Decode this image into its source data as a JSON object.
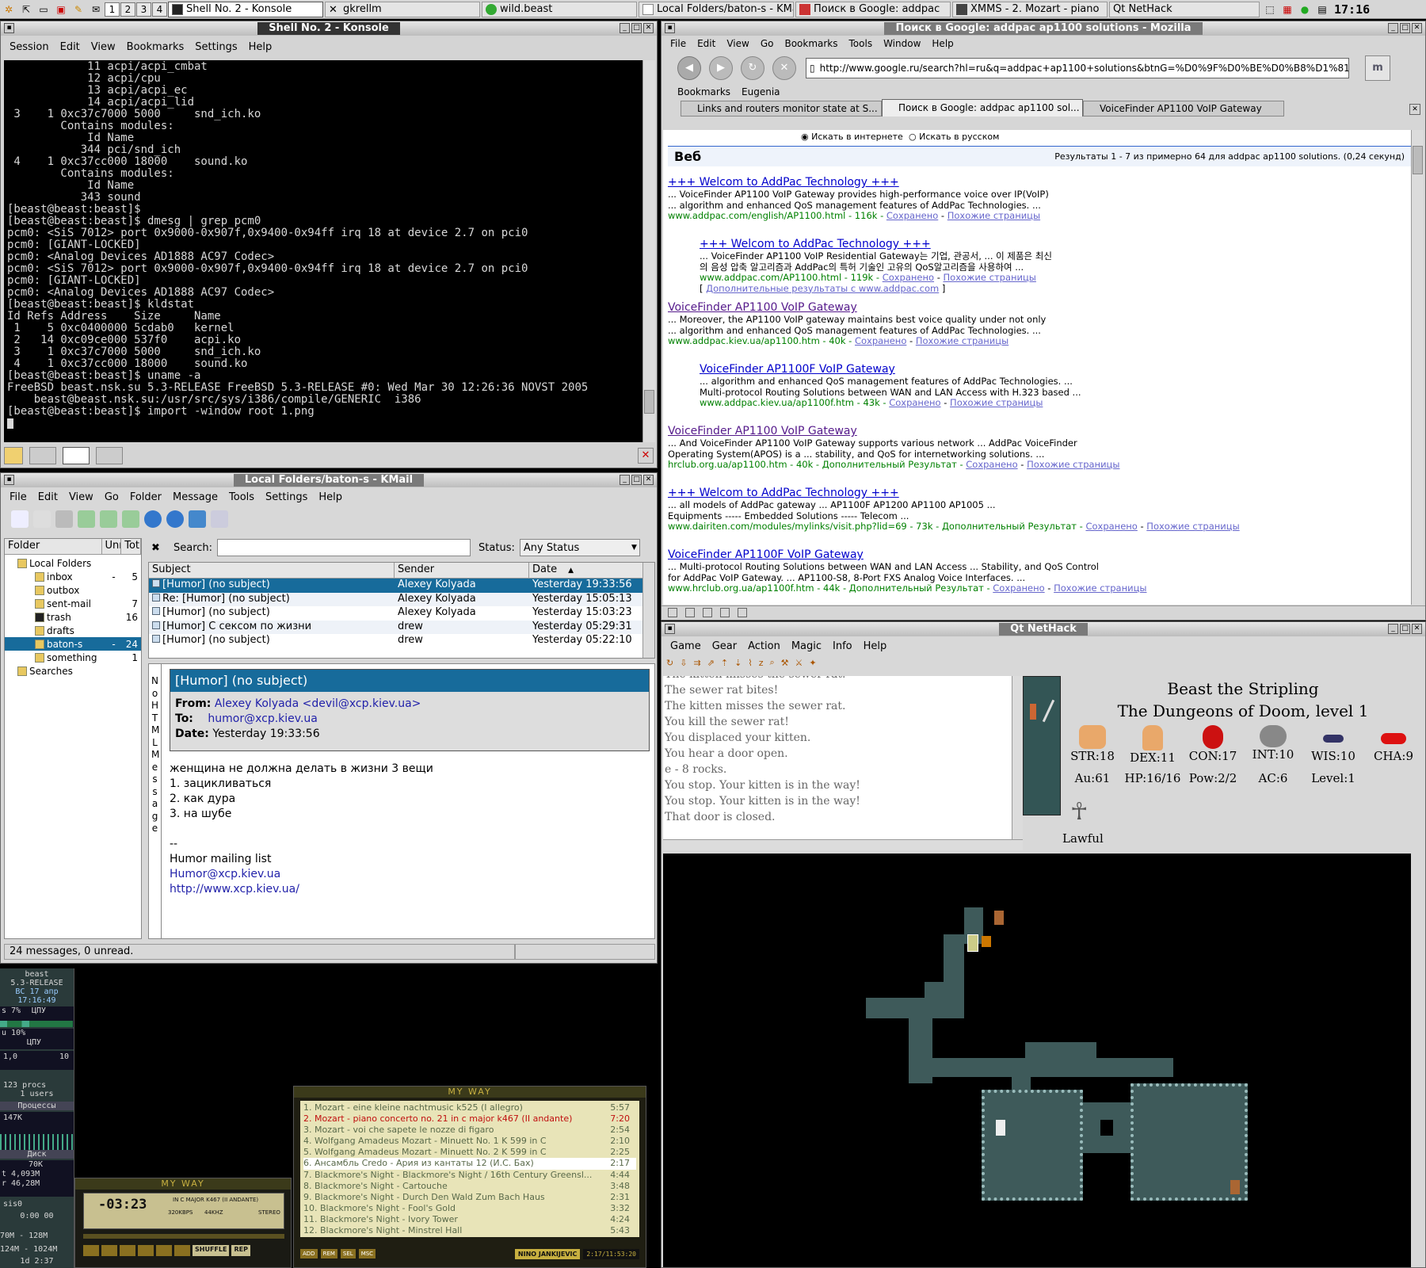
{
  "taskbar": {
    "desktops": [
      "1",
      "2",
      "3",
      "4"
    ],
    "tasks": [
      "Shell No. 2 - Konsole",
      "gkrellm",
      "wild.beast",
      "Local Folders/baton-s - KMail",
      "Поиск в Google: addpac",
      "XMMS - 2. Mozart - piano",
      "Qt NetHack"
    ],
    "clock": "17:16"
  },
  "konsole": {
    "title": "Shell No. 2 - Konsole",
    "menu": [
      "Session",
      "Edit",
      "View",
      "Bookmarks",
      "Settings",
      "Help"
    ],
    "lines": [
      "            11 acpi/acpi_cmbat",
      "            12 acpi/cpu",
      "            13 acpi/acpi_ec",
      "            14 acpi/acpi_lid",
      " 3    1 0xc37c7000 5000     snd_ich.ko",
      "        Contains modules:",
      "            Id Name",
      "           344 pci/snd_ich",
      " 4    1 0xc37cc000 18000    sound.ko",
      "        Contains modules:",
      "            Id Name",
      "           343 sound",
      "[beast@beast:beast]$",
      "[beast@beast:beast]$ dmesg | grep pcm0",
      "pcm0: <SiS 7012> port 0x9000-0x907f,0x9400-0x94ff irq 18 at device 2.7 on pci0",
      "pcm0: [GIANT-LOCKED]",
      "pcm0: <Analog Devices AD1888 AC97 Codec>",
      "pcm0: <SiS 7012> port 0x9000-0x907f,0x9400-0x94ff irq 18 at device 2.7 on pci0",
      "pcm0: [GIANT-LOCKED]",
      "pcm0: <Analog Devices AD1888 AC97 Codec>",
      "[beast@beast:beast]$ kldstat",
      "Id Refs Address    Size     Name",
      " 1    5 0xc0400000 5cdab0   kernel",
      " 2   14 0xc09ce000 537f0    acpi.ko",
      " 3    1 0xc37c7000 5000     snd_ich.ko",
      " 4    1 0xc37cc000 18000    sound.ko",
      "[beast@beast:beast]$ uname -a",
      "FreeBSD beast.nsk.su 5.3-RELEASE FreeBSD 5.3-RELEASE #0: Wed Mar 30 12:26:36 NOVST 2005",
      "    beast@beast.nsk.su:/usr/src/sys/i386/compile/GENERIC  i386",
      "[beast@beast:beast]$ import -window root 1.png"
    ]
  },
  "kmail": {
    "title": "Local Folders/baton-s - KMail",
    "menu": [
      "File",
      "Edit",
      "View",
      "Go",
      "Folder",
      "Message",
      "Tools",
      "Settings",
      "Help"
    ],
    "search_label": "Search:",
    "status_label": "Status:",
    "status_value": "Any Status",
    "folder_headers": [
      "Folder",
      "Unr",
      "Tot"
    ],
    "folders": [
      {
        "name": "Local Folders",
        "unread": "",
        "total": "",
        "level": 0
      },
      {
        "name": "inbox",
        "unread": "-",
        "total": "5",
        "level": 1
      },
      {
        "name": "outbox",
        "unread": "",
        "total": "",
        "level": 1
      },
      {
        "name": "sent-mail",
        "unread": "",
        "total": "7",
        "level": 1
      },
      {
        "name": "trash",
        "unread": "",
        "total": "16",
        "level": 1
      },
      {
        "name": "drafts",
        "unread": "",
        "total": "",
        "level": 1
      },
      {
        "name": "baton-s",
        "unread": "-",
        "total": "24",
        "level": 1
      },
      {
        "name": "something",
        "unread": "",
        "total": "1",
        "level": 1
      },
      {
        "name": "Searches",
        "unread": "",
        "total": "",
        "level": 0
      }
    ],
    "list_headers": [
      "Subject",
      "Sender",
      "Date"
    ],
    "messages": [
      {
        "subject": "[Humor] (no subject)",
        "sender": "Alexey Kolyada",
        "date": "Yesterday 19:33:56"
      },
      {
        "subject": "Re: [Humor] (no subject)",
        "sender": "Alexey Kolyada",
        "date": "Yesterday 15:05:13"
      },
      {
        "subject": "[Humor] (no subject)",
        "sender": "Alexey Kolyada",
        "date": "Yesterday 15:03:23"
      },
      {
        "subject": "[Humor] С сексом по жизни",
        "sender": "drew",
        "date": "Yesterday 05:29:31"
      },
      {
        "subject": "[Humor] (no subject)",
        "sender": "drew",
        "date": "Yesterday 05:22:10"
      }
    ],
    "side_label": "No HTML Message",
    "preview": {
      "subject": "[Humor] (no subject)",
      "from_label": "From:",
      "from": "Alexey Kolyada <devil@xcp.kiev.ua>",
      "to_label": "To:",
      "to": "humor@xcp.kiev.ua",
      "date_label": "Date:",
      "date": "Yesterday 19:33:56",
      "body": [
        "женщина не должна делать в жизни 3 вещи",
        "1. зацикливаться",
        "2. как дура",
        "3. на шубе"
      ],
      "sig_dash": "--",
      "sig_list": "Humor mailing list",
      "sig_mail": "Humor@xcp.kiev.ua",
      "sig_url": "http://www.xcp.kiev.ua/"
    },
    "statusbar": "24 messages, 0 unread."
  },
  "mozilla": {
    "title": "Поиск в Google: addpac ap1100 solutions - Mozilla",
    "menu": [
      "File",
      "Edit",
      "View",
      "Go",
      "Bookmarks",
      "Tools",
      "Window",
      "Help"
    ],
    "url": "http://www.google.ru/search?hl=ru&q=addpac+ap1100+solutions&btnG=%D0%9F%D0%BE%D0%B8%D1%81",
    "bookmarks": [
      "Bookmarks",
      "Eugenia"
    ],
    "tabs": [
      "Links and routers monitor state at S...",
      "Поиск в Google: addpac ap1100 sol...",
      "VoiceFinder AP1100 VoIP Gateway"
    ],
    "radio1": "Искать в интернете",
    "radio2": "Искать в русском",
    "web_label": "Веб",
    "results_info": "Результаты 1 - 7 из примерно 64 для addpac ap1100 solutions. (0,24 секунд)",
    "results": [
      {
        "title": "+++ Welcom to AddPac Technology +++",
        "s1": "... VoiceFinder AP1100 VoIP Gateway provides high-performance voice over IP(VoIP)",
        "s2": "... algorithm and enhanced QoS management features of AddPac Technologies. ...",
        "url": "www.addpac.com/english/AP1100.html - 116k - ",
        "c1": "Сохранено",
        "c2": "Похожие страницы",
        "more": ""
      },
      {
        "title": "+++ Welcom to AddPac Technology +++",
        "s1": "... VoiceFinder AP1100 VoIP Residential Gateway는 기업, 관공서, ... 이 제품은 최신",
        "s2": "의 음성 압축 알고리즘과 AddPac의 특허 기술인 고유의 QoS알고리즘을 사용하여 ...",
        "url": "www.addpac.com/AP1100.html - 119k - ",
        "c1": "Сохранено",
        "c2": "Похожие страницы",
        "more": "Дополнительные результаты с www.addpac.com"
      },
      {
        "title": "VoiceFinder AP1100 VoIP Gateway",
        "s1": "... Moreover, the AP1100 VoIP gateway maintains best voice quality under not only",
        "s2": "... algorithm and enhanced QoS management features of AddPac Technologies. ...",
        "url": "www.addpac.kiev.ua/ap1100.htm - 40k - ",
        "c1": "Сохранено",
        "c2": "Похожие страницы",
        "more": ""
      },
      {
        "title": "VoiceFinder AP1100F VoIP Gateway",
        "s1": "... algorithm and enhanced QoS management features of AddPac Technologies. ...",
        "s2": "Multi-protocol Routing Solutions between WAN and LAN Access with H.323 based ...",
        "url": "www.addpac.kiev.ua/ap1100f.htm - 43k - ",
        "c1": "Сохранено",
        "c2": "Похожие страницы",
        "more": ""
      },
      {
        "title": "VoiceFinder AP1100 VoIP Gateway",
        "s1": "... And VoiceFinder AP1100 VoIP Gateway supports various network ... AddPac VoiceFinder",
        "s2": "Operating System(APOS) is a ... stability, and QoS for internetworking solutions. ...",
        "url": "hrclub.org.ua/ap1100.htm - 40k - Дополнительный Результат - ",
        "c1": "Сохранено",
        "c2": "Похожие страницы",
        "more": ""
      },
      {
        "title": "+++ Welcom to AddPac Technology +++",
        "s1": "... all models of AddPac gateway ... AP1100F AP1200 AP1100 AP1005 ...",
        "s2": "Equipments ----- Embedded Solutions ----- Telecom ...",
        "url": "www.dairiten.com/modules/mylinks/visit.php?lid=69 - 73k - Дополнительный Результат - ",
        "c1": "Сохранено",
        "c2": "Похожие страницы",
        "more": ""
      },
      {
        "title": "VoiceFinder AP1100F VoIP Gateway",
        "s1": "... Multi-protocol Routing Solutions between WAN and LAN Access ... Stability, and QoS Control",
        "s2": "for AddPac VoIP Gateway. ... AP1100-S8, 8-Port FXS Analog Voice Interfaces. ...",
        "url": "www.hrclub.org.ua/ap1100f.htm - 44k - Дополнительный Результат - ",
        "c1": "Сохранено",
        "c2": "Похожие страницы",
        "more": ""
      }
    ]
  },
  "nethack": {
    "title": "Qt NetHack",
    "menu": [
      "Game",
      "Gear",
      "Action",
      "Magic",
      "Info",
      "Help"
    ],
    "messages": [
      "The kitten misses the sewer rat.",
      "The sewer rat bites!",
      "The kitten misses the sewer rat.",
      "You kill the sewer rat!",
      "You displaced your kitten.",
      "You hear a door open.",
      "e - 8 rocks.",
      "You stop.  Your kitten is in the way!",
      "You stop.  Your kitten is in the way!",
      "That door is closed."
    ],
    "name": "Beast the Stripling",
    "dungeon": "The Dungeons of Doom, level 1",
    "stats": [
      "STR:18",
      "DEX:11",
      "CON:17",
      "INT:10",
      "WIS:10",
      "CHA:9"
    ],
    "status": [
      "Au:61",
      "HP:16/16",
      "Pow:2/2",
      "AC:6",
      "Level:1"
    ],
    "alignment": "Lawful"
  },
  "xmms": {
    "playlist_title": "MY WAY",
    "main_title": "MY WAY",
    "time": "-03:23",
    "song": "IN C MAJOR K467 (II ANDANTE)",
    "kbps": "320KBPS",
    "khz": "44KHZ",
    "stereo": "STEREO",
    "buttons": [
      "SHUFFLE",
      "REP"
    ],
    "pl_buttons": [
      "ADD",
      "REM",
      "SEL",
      "MSC"
    ],
    "playlist": [
      {
        "t": "1. Mozart -  eine kleine nachtmusic k525 (I allegro)",
        "d": "5:57"
      },
      {
        "t": "2. Mozart - piano concerto no. 21 in c major k467 (II andante)",
        "d": "7:20"
      },
      {
        "t": "3. Mozart - voi che sapete le nozze di figaro",
        "d": "2:54"
      },
      {
        "t": "4. Wolfgang Amadeus Mozart - Minuett No. 1 K 599 in C",
        "d": "2:10"
      },
      {
        "t": "5. Wolfgang Amadeus Mozart - Minuett No. 2 K 599 in C",
        "d": "2:25"
      },
      {
        "t": "6. Ансамбль Credo - Ария из кантаты  12 (И.С. Бах)",
        "d": "2:17"
      },
      {
        "t": "7. Blackmore's Night - Blackmore's Night / 16th Century Greensl...",
        "d": "4:44"
      },
      {
        "t": "8. Blackmore's Night - Cartouche",
        "d": "3:48"
      },
      {
        "t": "9. Blackmore's Night - Durch Den Wald Zum Bach Haus",
        "d": "2:31"
      },
      {
        "t": "10. Blackmore's Night - Fool's Gold",
        "d": "3:32"
      },
      {
        "t": "11. Blackmore's Night - Ivory Tower",
        "d": "4:24"
      },
      {
        "t": "12. Blackmore's Night - Minstrel Hall",
        "d": "5:43"
      }
    ],
    "footer": "NINO JANKIJEVIC",
    "counter": "2:17/11:53:20"
  },
  "gkrellm": {
    "host": "beast",
    "os": "5.3-RELEASE",
    "date": "ВС 17 апр",
    "time": "17:16:49",
    "cpu_pct": "s 7%",
    "cpu_label": "ЦПУ",
    "cpu_pct2": "u 10%",
    "cpu_label2": "ЦПУ",
    "load": "1,0",
    "load_max": "10",
    "procs": "123 procs",
    "users": "1 users",
    "procs_label": "Процессы",
    "disk_val": "147K",
    "disk_label": "Диск",
    "net1": "70K",
    "net2": "t 4,093M",
    "net3": "r 46,28M",
    "sis": "sis0",
    "sis_time": "0:00  00",
    "mem1": "70M - 128M",
    "mem2": "124M - 1024M",
    "uptime": "1d  2:37"
  },
  "colors": {
    "accent": "#176b9b",
    "google_link": "#0000cc",
    "google_url": "#008000",
    "terminal_bg": "#000000"
  }
}
